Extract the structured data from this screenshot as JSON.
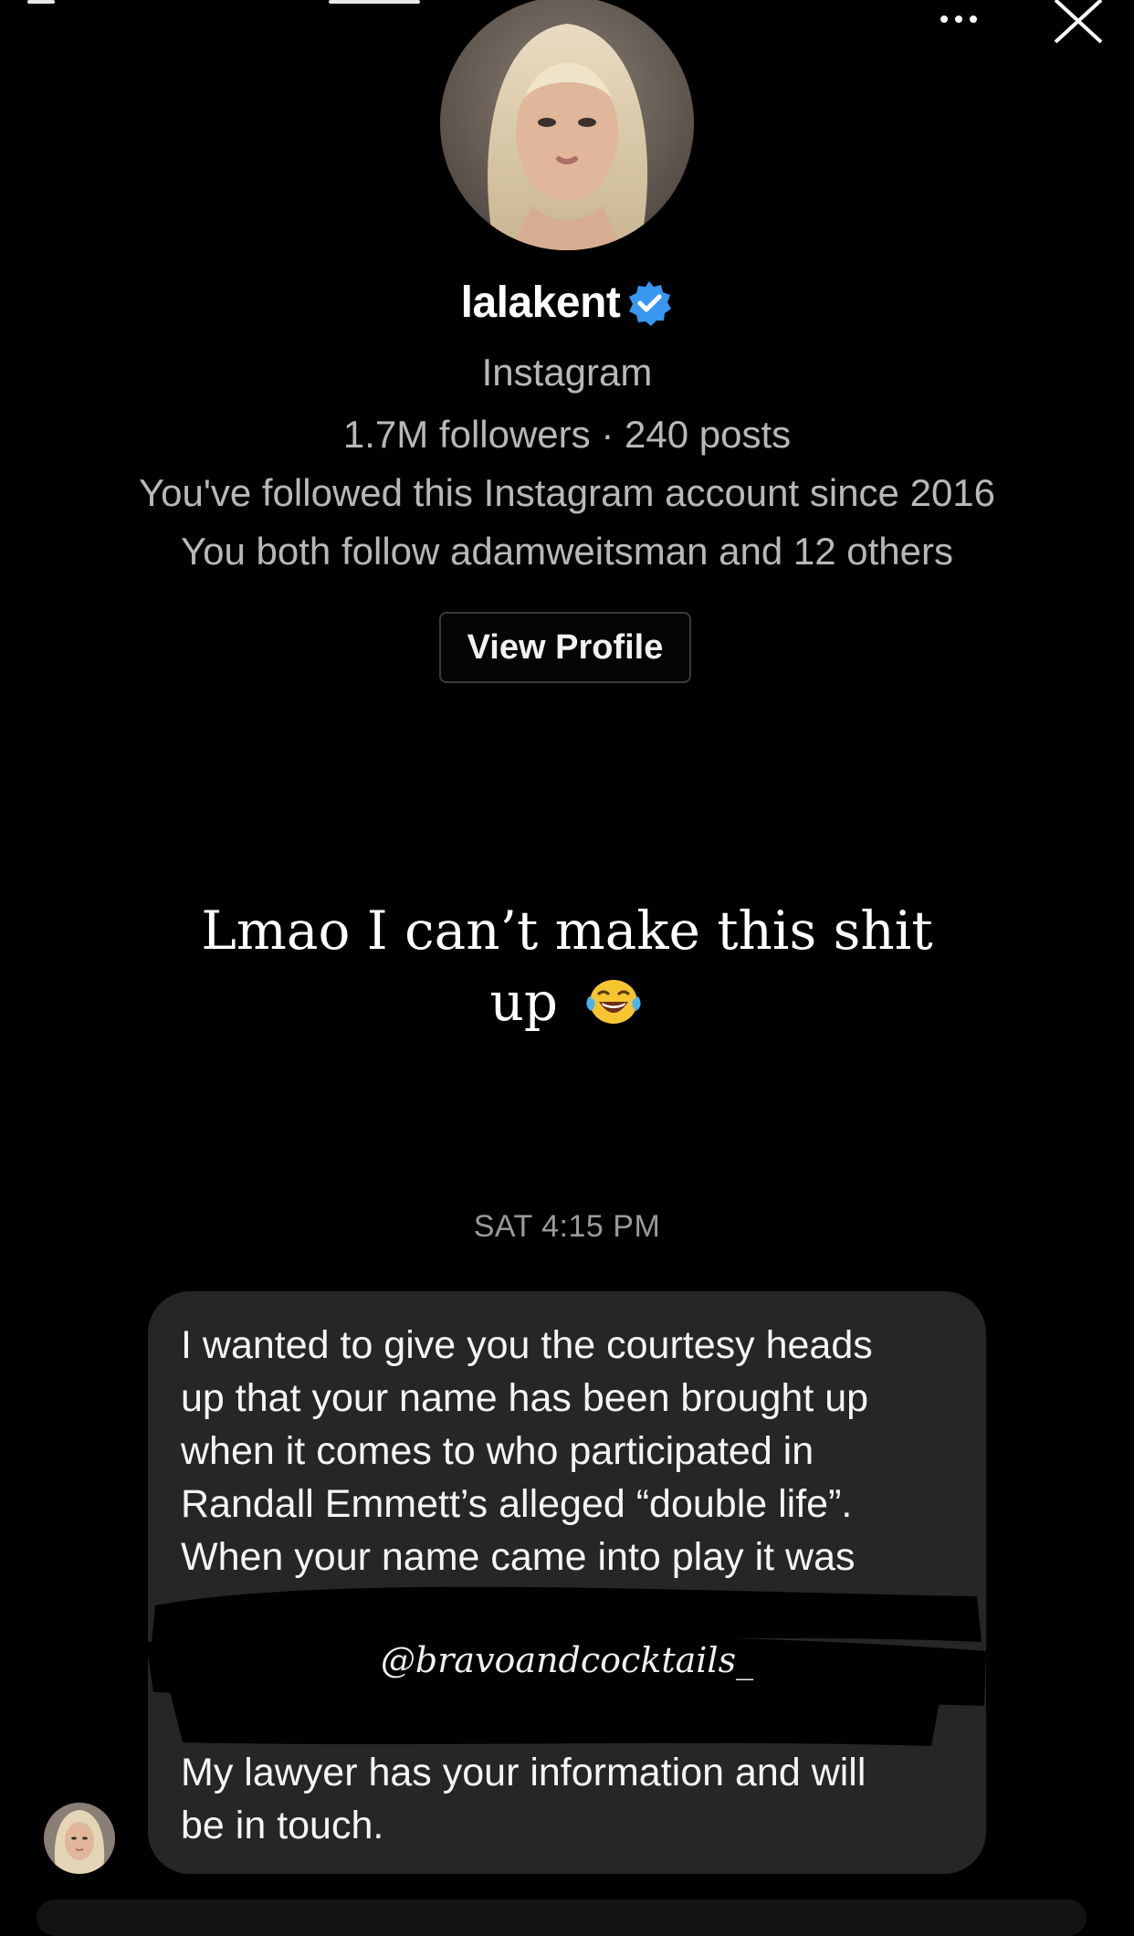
{
  "header": {
    "more_icon": "more-horizontal-icon",
    "close_icon": "close-icon"
  },
  "profile": {
    "username": "lalakent",
    "verified_icon": "verified-badge-icon",
    "platform": "Instagram",
    "stats": "1.7M followers · 240 posts",
    "followed_since": "You've followed this Instagram account since 2016",
    "mutual": "You both follow adamweitsman and 12 others",
    "view_profile_label": "View Profile"
  },
  "caption": {
    "line1": "Lmao I can’t make this shit",
    "line2": "up",
    "emoji": "face-with-tears-of-joy"
  },
  "conversation": {
    "timestamp": "SAT 4:15 PM",
    "message_lines_top": [
      "I wanted to give you the courtesy heads",
      "up that your name has been brought up",
      "when it comes to who participated in",
      "Randall Emmett’s alleged “double life”.",
      "When your name came into play it was"
    ],
    "message_lines_bottom": [
      "My lawyer has your information and will",
      "be in touch."
    ]
  },
  "watermark": "@bravoandcocktails_",
  "colors": {
    "background": "#000000",
    "bubble": "#262626",
    "secondary_text": "#b8b8b8",
    "verified_blue": "#3897f0"
  }
}
